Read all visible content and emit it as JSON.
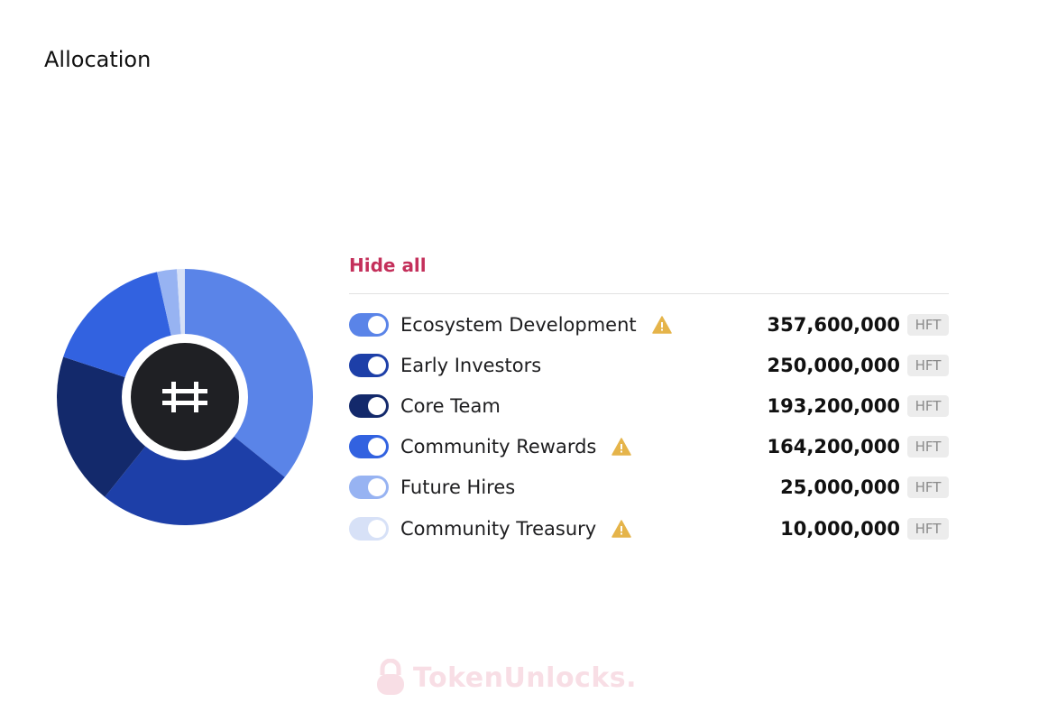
{
  "page": {
    "title": "Allocation"
  },
  "legend": {
    "hide_all_label": "Hide all"
  },
  "chart_data": {
    "type": "pie",
    "unit": "HFT",
    "items": [
      {
        "label": "Ecosystem Development",
        "amount": "357,600,000",
        "value": 357600000,
        "color": "#5a84e8",
        "warning": true
      },
      {
        "label": "Early Investors",
        "amount": "250,000,000",
        "value": 250000000,
        "color": "#1d3fa8",
        "warning": false
      },
      {
        "label": "Core Team",
        "amount": "193,200,000",
        "value": 193200000,
        "color": "#13296b",
        "warning": false
      },
      {
        "label": "Community Rewards",
        "amount": "164,200,000",
        "value": 164200000,
        "color": "#3262e0",
        "warning": true
      },
      {
        "label": "Future Hires",
        "amount": "25,000,000",
        "value": 25000000,
        "color": "#97b3f2",
        "warning": false
      },
      {
        "label": "Community Treasury",
        "amount": "10,000,000",
        "value": 10000000,
        "color": "#d7e1f7",
        "warning": true
      }
    ]
  },
  "colors": {
    "accent": "#c4305b",
    "warning": "#e5b44a",
    "logo_background": "#1f2024"
  },
  "icons": {
    "center": "hashflow-logo-icon",
    "warning": "warning-triangle-icon",
    "watermark": "padlock-icon"
  },
  "watermark": {
    "text": "TokenUnlocks."
  }
}
